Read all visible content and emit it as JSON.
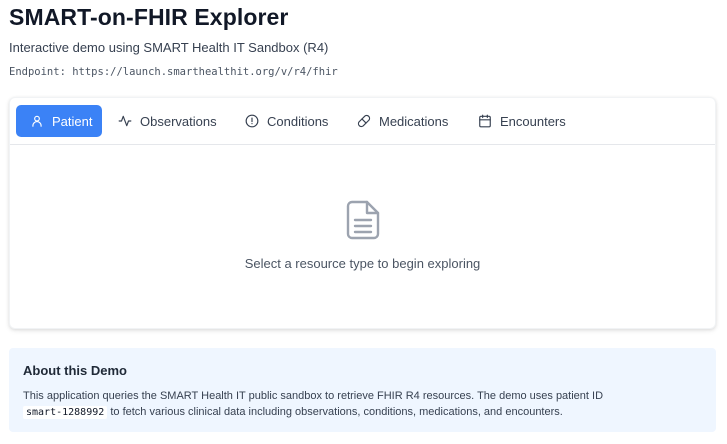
{
  "header": {
    "title": "SMART-on-FHIR Explorer",
    "subtitle": "Interactive demo using SMART Health IT Sandbox (R4)",
    "endpoint": "Endpoint: https://launch.smarthealthit.org/v/r4/fhir"
  },
  "tabs": [
    {
      "label": "Patient",
      "icon": "user-icon",
      "active": true
    },
    {
      "label": "Observations",
      "icon": "activity-icon",
      "active": false
    },
    {
      "label": "Conditions",
      "icon": "alert-circle-icon",
      "active": false
    },
    {
      "label": "Medications",
      "icon": "pill-icon",
      "active": false
    },
    {
      "label": "Encounters",
      "icon": "calendar-icon",
      "active": false
    }
  ],
  "empty_state": {
    "icon": "document-icon",
    "message": "Select a resource type to begin exploring"
  },
  "about": {
    "title": "About this Demo",
    "text_before": "This application queries the SMART Health IT public sandbox to retrieve FHIR R4 resources. The demo uses patient ID",
    "patient_id": "smart-1288992",
    "text_after": "to fetch various clinical data including observations, conditions, medications, and encounters."
  },
  "colors": {
    "accent": "#3b82f6",
    "info_bg": "#eff6ff"
  }
}
